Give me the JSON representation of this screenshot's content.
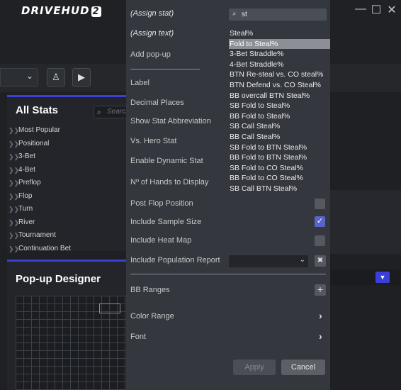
{
  "app": {
    "logo_text": "DRIVEHUD",
    "logo_version": "2",
    "window_controls": {
      "minimize": "—",
      "maximize": "☐",
      "close": "✕"
    }
  },
  "toolbar": {
    "profile_chevron": "⌄",
    "hud_icon": "♙",
    "video_icon": "▶"
  },
  "all_stats": {
    "title": "All Stats",
    "search_placeholder": "Search",
    "categories": [
      "Most Popular",
      "Positional",
      "3-Bet",
      "4-Bet",
      "Preflop",
      "Flop",
      "Turn",
      "River",
      "Tournament",
      "Continuation Bet"
    ]
  },
  "designer": {
    "title": "Pop-up Designer"
  },
  "dialog": {
    "assign_stat": "(Assign stat)",
    "assign_text": "(Assign text)",
    "add_popup": "Add pop-up",
    "label": "Label",
    "decimal_places": "Decimal Places",
    "show_abbrev": "Show Stat Abbreviation",
    "vs_hero": "Vs. Hero Stat",
    "dynamic_stat": "Enable Dynamic Stat",
    "hands_to_display": "Nº of Hands to Display",
    "post_flop": "Post Flop Position",
    "sample_size": "Include Sample Size",
    "heat_map": "Include Heat Map",
    "population_report": "Include Population Report",
    "bb_ranges": "BB Ranges",
    "color_range": "Color Range",
    "font": "Font",
    "apply": "Apply",
    "cancel": "Cancel",
    "search_value": "st",
    "checkbox_states": {
      "post_flop": false,
      "sample_size": true,
      "heat_map": false
    },
    "suggestions": [
      "Steal%",
      "Fold to Steal%",
      "3-Bet Straddle%",
      "4-Bet Straddle%",
      "BTN Re-steal vs. CO steal%",
      "BTN Defend vs. CO Steal%",
      "BB overcall BTN Steal%",
      "SB Fold to Steal%",
      "BB Fold to Steal%",
      "SB Call Steal%",
      "BB Call Steal%",
      "SB Fold to BTN Steal%",
      "BB Fold to BTN Steal%",
      "SB Fold to CO Steal%",
      "BB Fold to CO Steal%",
      "SB Call BTN Steal%"
    ],
    "selected_suggestion": "Fold to Steal%"
  },
  "colors": {
    "accent": "#3a3fd8",
    "checkbox_on": "#5865c7",
    "dialog_bg": "#34373d",
    "app_bg": "#1e2024"
  }
}
